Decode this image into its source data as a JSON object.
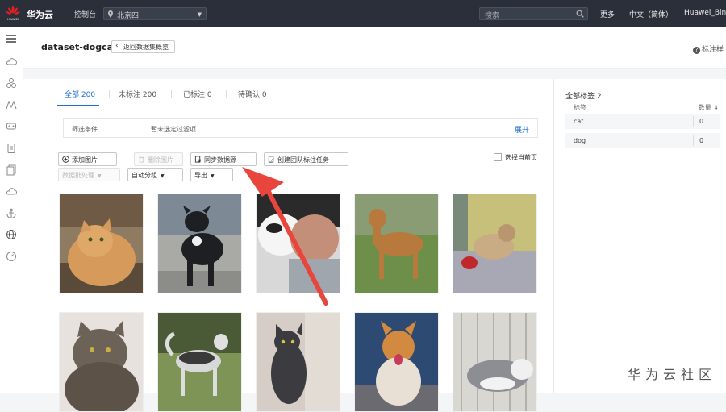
{
  "topbar": {
    "brand": "华为云",
    "console": "控制台",
    "region": "北京四",
    "search_placeholder": "搜索",
    "more": "更多",
    "language": "中文（简体）",
    "user": "Huawei_Bin",
    "logo_text": "HUAWEI"
  },
  "sidebar": {
    "icons": [
      "cloud-icon",
      "cluster-icon",
      "mountain-icon",
      "monitor-icon",
      "document-icon",
      "copy-icon",
      "cloud-outline-icon",
      "anchor-icon",
      "globe-icon",
      "dashboard-icon"
    ]
  },
  "header": {
    "title": "dataset-dogcat",
    "back_label": "返回数据集概览",
    "help_label": "标注样"
  },
  "tabs": [
    {
      "label": "全部 200",
      "active": true
    },
    {
      "label": "未标注 200",
      "active": false
    },
    {
      "label": "已标注 0",
      "active": false
    },
    {
      "label": "待确认 0",
      "active": false
    }
  ],
  "filter": {
    "label": "筛选条件",
    "value": "暂未选定过滤项",
    "expand": "展开"
  },
  "toolbar": {
    "add_image": "添加图片",
    "delete_image": "删除图片",
    "sync_source": "同步数据源",
    "create_team_task": "创建团队标注任务",
    "batch_process": "数据批处理",
    "auto_group": "自动分组",
    "export": "导出",
    "select_page": "选择当前页"
  },
  "images": [
    {
      "name": "cat"
    },
    {
      "name": "dog"
    },
    {
      "name": "dog"
    },
    {
      "name": "dog"
    },
    {
      "name": "dog"
    },
    {
      "name": "cat"
    },
    {
      "name": "dog"
    },
    {
      "name": "cat"
    },
    {
      "name": "dog"
    },
    {
      "name": "cat"
    }
  ],
  "labels_panel": {
    "title": "全部标签  2",
    "col_label": "标签",
    "col_count": "数量 ⬍",
    "rows": [
      {
        "label": "cat",
        "count": "0"
      },
      {
        "label": "dog",
        "count": "0"
      }
    ]
  },
  "watermark": "华为云社区",
  "colors": {
    "accent": "#1f6fd1",
    "topbar": "#2b2f3a",
    "annotation_arrow": "#e8453c"
  }
}
